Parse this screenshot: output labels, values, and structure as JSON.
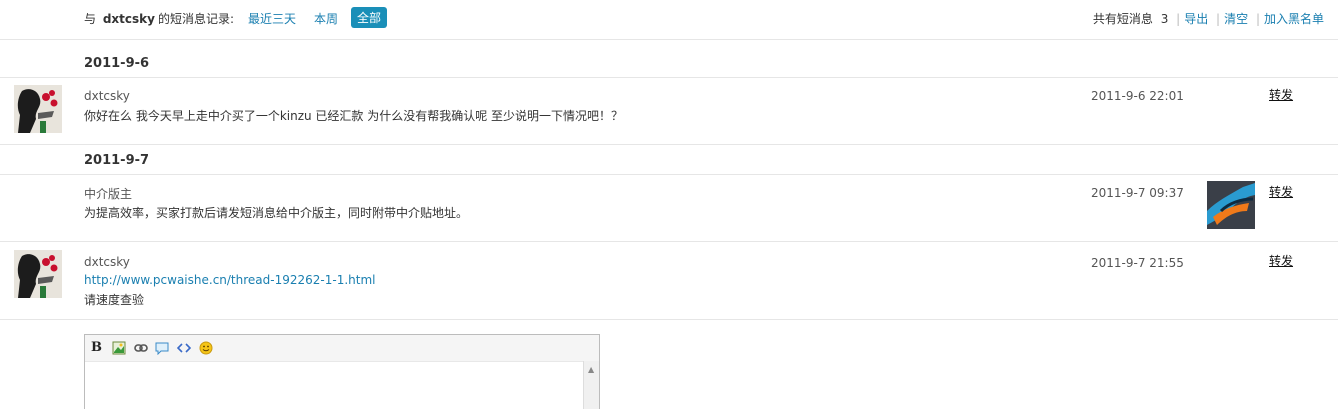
{
  "header": {
    "intro_prefix": "与",
    "username": "dxtcsky",
    "intro_suffix": "的短消息记录:",
    "filters": [
      "最近三天",
      "本周",
      "全部"
    ],
    "active_filter": "全部",
    "total_label": "共有短消息",
    "total_count": "3",
    "actions": [
      "导出",
      "清空",
      "加入黑名单"
    ]
  },
  "groups": [
    {
      "date": "2011-9-6",
      "messages": [
        {
          "sender": "dxtcsky",
          "time": "2011-9-6 22:01",
          "lines": [
            "你好在么  我今天早上走中介买了一个kinzu 已经汇款  为什么没有帮我确认呢  至少说明一下情况吧！？"
          ],
          "forward_label": "转发"
        }
      ]
    },
    {
      "date": "2011-9-7",
      "messages": [
        {
          "sender": "中介版主",
          "time": "2011-9-7 09:37",
          "lines": [
            "为提高效率，买家打款后请发短消息给中介版主，同时附带中介贴地址。"
          ],
          "forward_label": "转发"
        },
        {
          "sender": "dxtcsky",
          "time": "2011-9-7 21:55",
          "link": "http://www.pcwaishe.cn/thread-192262-1-1.html",
          "lines": [
            "请速度查验"
          ],
          "forward_label": "转发"
        }
      ]
    }
  ],
  "editor": {
    "toolbar_icons": [
      "bold-icon",
      "image-icon",
      "link-icon",
      "quote-icon",
      "code-icon",
      "smiley-icon"
    ],
    "bold_label": "B"
  },
  "colors": {
    "link": "#1a7fb0",
    "active_filter_bg": "#1a8fb8",
    "divider": "#e6e6e6"
  }
}
